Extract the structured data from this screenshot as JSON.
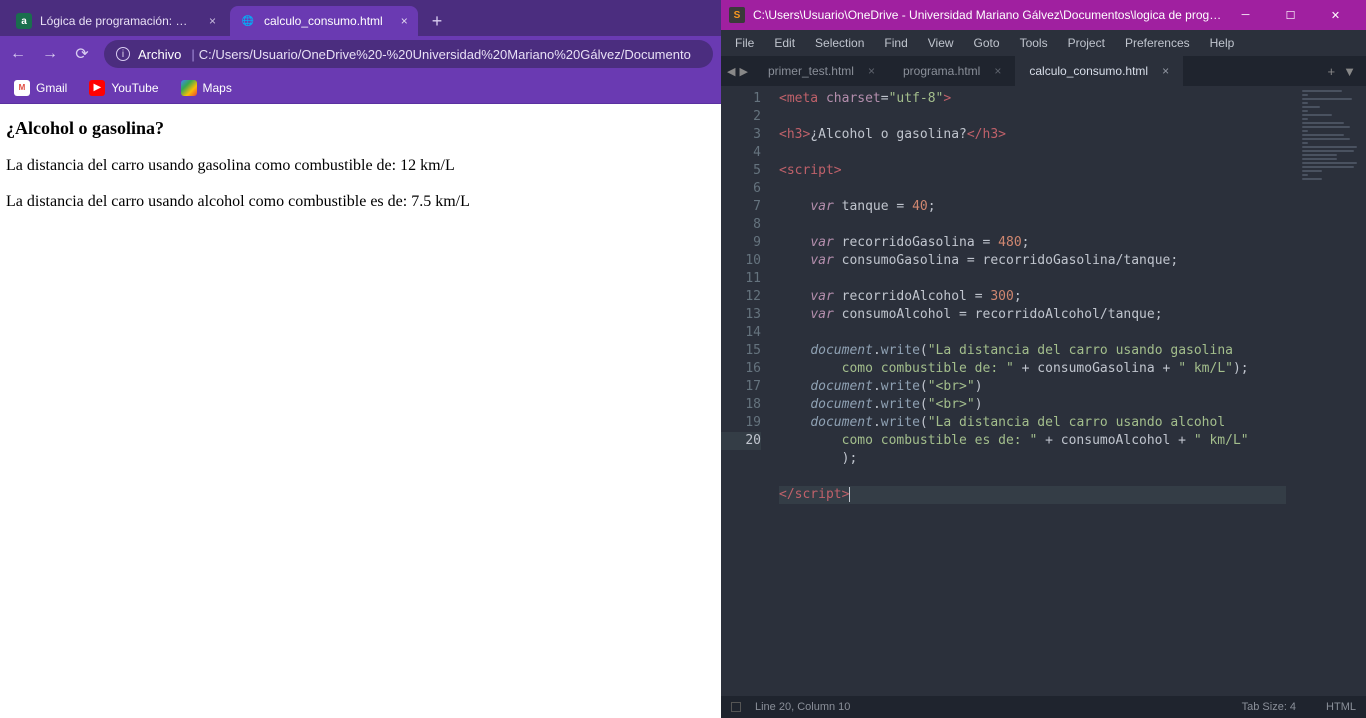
{
  "chrome": {
    "tabs": [
      {
        "title": "Lógica de programación: Primero",
        "active": false
      },
      {
        "title": "calculo_consumo.html",
        "active": true
      }
    ],
    "address": {
      "scheme": "Archivo",
      "path": "C:/Users/Usuario/OneDrive%20-%20Universidad%20Mariano%20Gálvez/Documento"
    },
    "bookmarks": {
      "gmail": "Gmail",
      "youtube": "YouTube",
      "maps": "Maps"
    },
    "page": {
      "heading": "¿Alcohol o gasolina?",
      "line1": "La distancia del carro usando gasolina como combustible de: 12 km/L",
      "line2": "La distancia del carro usando alcohol como combustible es de: 7.5 km/L"
    }
  },
  "sublime": {
    "title": "C:\\Users\\Usuario\\OneDrive - Universidad Mariano Gálvez\\Documentos\\logica de progra...",
    "menu": [
      "File",
      "Edit",
      "Selection",
      "Find",
      "View",
      "Goto",
      "Tools",
      "Project",
      "Preferences",
      "Help"
    ],
    "tabs": [
      "primer_test.html",
      "programa.html",
      "calculo_consumo.html"
    ],
    "activeTab": 2,
    "lines": [
      "1",
      "2",
      "3",
      "4",
      "5",
      "6",
      "7",
      "8",
      "9",
      "10",
      "11",
      "12",
      "13",
      "14",
      "15",
      "",
      "16",
      "17",
      "18",
      "",
      "",
      "19",
      "20"
    ],
    "status": {
      "pos": "Line 20, Column 10",
      "tab": "Tab Size: 4",
      "lang": "HTML"
    },
    "code": {
      "l1a": "<",
      "l1b": "meta",
      "l1c": " charset",
      "l1d": "=",
      "l1e": "\"utf-8\"",
      "l1f": ">",
      "l3a": "<",
      "l3b": "h3",
      "l3c": ">",
      "l3d": "¿Alcohol o gasolina?",
      "l3e": "</",
      "l3f": "h3",
      "l3g": ">",
      "l5a": "<",
      "l5b": "script",
      "l5c": ">",
      "l7a": "    ",
      "l7b": "var",
      "l7c": " tanque ",
      "l7d": "=",
      "l7e": " ",
      "l7f": "40",
      "l7g": ";",
      "l9a": "    ",
      "l9b": "var",
      "l9c": " recorridoGasolina ",
      "l9d": "=",
      "l9e": " ",
      "l9f": "480",
      "l9g": ";",
      "l10a": "    ",
      "l10b": "var",
      "l10c": " consumoGasolina ",
      "l10d": "=",
      "l10e": " recorridoGasolina",
      "l10f": "/",
      "l10g": "tanque;",
      "l12a": "    ",
      "l12b": "var",
      "l12c": " recorridoAlcohol ",
      "l12d": "=",
      "l12e": " ",
      "l12f": "300",
      "l12g": ";",
      "l13a": "    ",
      "l13b": "var",
      "l13c": " consumoAlcohol ",
      "l13d": "=",
      "l13e": " recorridoAlcohol",
      "l13f": "/",
      "l13g": "tanque;",
      "l15a": "    ",
      "l15b": "document",
      "l15c": ".",
      "l15d": "write",
      "l15e": "(",
      "l15f": "\"La distancia del carro usando gasolina ",
      "l15g": "        como combustible de: \"",
      "l15h": " + ",
      "l15i": "consumoGasolina",
      "l15j": " + ",
      "l15k": "\" km/L\"",
      "l15l": ");",
      "l16a": "    ",
      "l16b": "document",
      "l16c": ".",
      "l16d": "write",
      "l16e": "(",
      "l16f": "\"<br>\"",
      "l16g": ")",
      "l17a": "    ",
      "l17b": "document",
      "l17c": ".",
      "l17d": "write",
      "l17e": "(",
      "l17f": "\"<br>\"",
      "l17g": ")",
      "l18a": "    ",
      "l18b": "document",
      "l18c": ".",
      "l18d": "write",
      "l18e": "(",
      "l18f": "\"La distancia del carro usando alcohol ",
      "l18g": "        como combustible es de: \"",
      "l18h": " + ",
      "l18i": "consumoAlcohol",
      "l18j": " + ",
      "l18k": "\" km/L\"",
      "l18l": "        );",
      "l20a": "</",
      "l20b": "script",
      "l20c": ">"
    }
  }
}
